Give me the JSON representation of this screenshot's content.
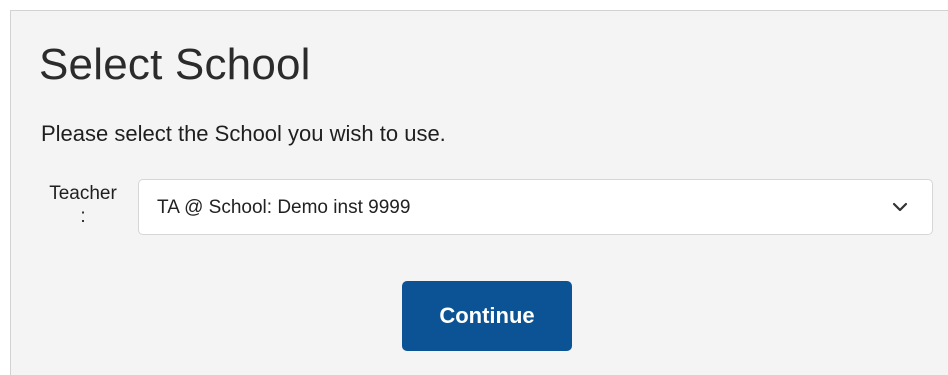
{
  "page": {
    "title": "Select School",
    "prompt": "Please select the School you wish to use."
  },
  "form": {
    "label_text": "Teacher",
    "label_colon": ":",
    "select": {
      "selected_value": "TA @ School: Demo inst 9999"
    },
    "continue_label": "Continue"
  },
  "icons": {
    "dropdown": "chevron-down-icon"
  },
  "colors": {
    "primary_button": "#0b5394",
    "panel_background": "#f4f4f4"
  }
}
